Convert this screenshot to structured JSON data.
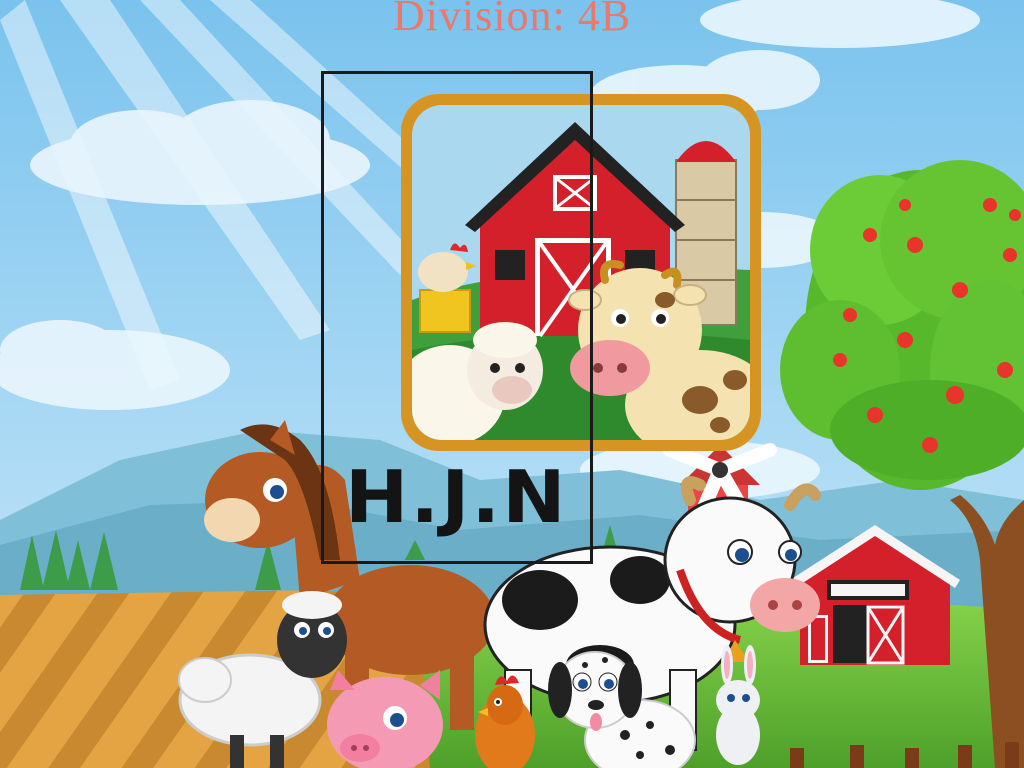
{
  "header": {
    "title": "Division: 4B"
  },
  "logo": {
    "text": "H.J.N",
    "icon": "farm-app-icon"
  },
  "scene": {
    "icon": "farm-animals-illustration"
  },
  "colors": {
    "title": "#e8796c",
    "sky": "#9fd4f2",
    "grass": "#6bbf3a",
    "barn": "#d3202a",
    "frame": "#1a1a1a"
  }
}
